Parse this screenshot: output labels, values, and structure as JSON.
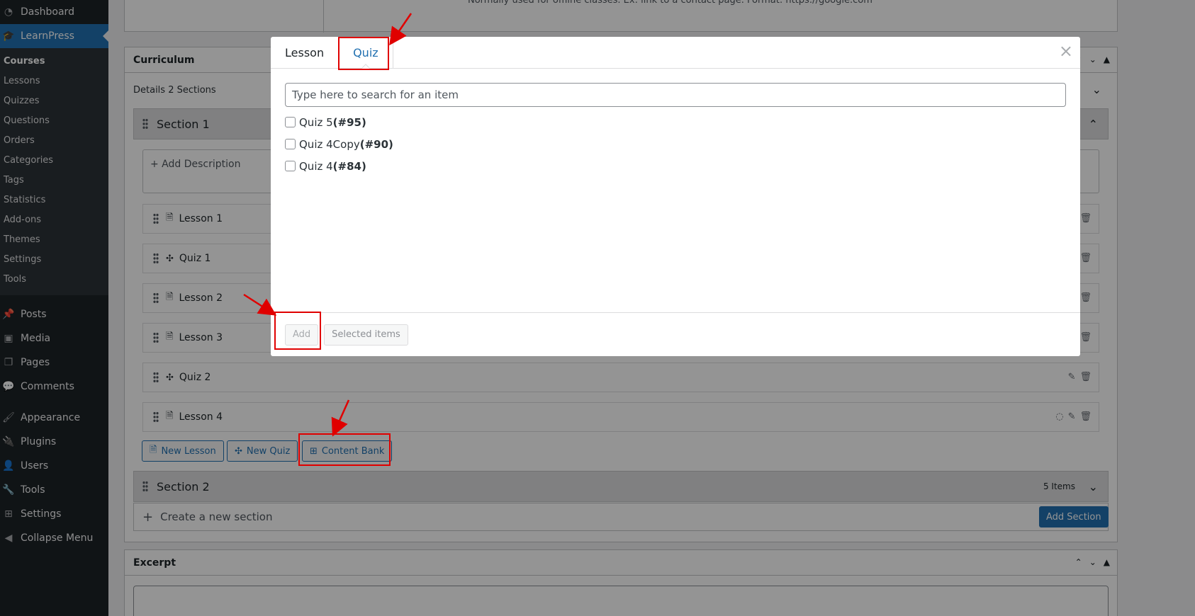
{
  "sidebar": {
    "dashboard": "Dashboard",
    "learnpress": "LearnPress",
    "learnpress_items": [
      "Courses",
      "Lessons",
      "Quizzes",
      "Questions",
      "Orders",
      "Categories",
      "Tags",
      "Statistics",
      "Add-ons",
      "Themes",
      "Settings",
      "Tools"
    ],
    "posts": "Posts",
    "media": "Media",
    "pages": "Pages",
    "comments": "Comments",
    "appearance": "Appearance",
    "plugins": "Plugins",
    "users": "Users",
    "tools": "Tools",
    "settings": "Settings",
    "collapse": "Collapse Menu"
  },
  "top_note": "Normally used for offline classes. Ex: link to a contact page. Format: https://google.com",
  "curriculum": {
    "title": "Curriculum",
    "details_label": "Details",
    "sections_count": "2 Sections",
    "section1": "Section 1",
    "add_description": "+ Add Description",
    "items": [
      "Lesson 1",
      "Quiz 1",
      "Lesson 2",
      "Lesson 3",
      "Quiz 2",
      "Lesson 4"
    ],
    "new_lesson": "New Lesson",
    "new_quiz": "New Quiz",
    "content_bank": "Content Bank",
    "section2": "Section 2",
    "section2_count": "5 Items",
    "create_section_placeholder": "Create a new section",
    "add_section": "Add Section"
  },
  "excerpt": {
    "title": "Excerpt"
  },
  "modal": {
    "tab_lesson": "Lesson",
    "tab_quiz": "Quiz",
    "close": "×",
    "search_placeholder": "Type here to search for an item",
    "options": [
      {
        "name": "Quiz 5",
        "id": "(#95)"
      },
      {
        "name": "Quiz 4Copy",
        "id": "(#90)"
      },
      {
        "name": "Quiz 4",
        "id": "(#84)"
      }
    ],
    "add_button": "Add",
    "selected_items": "Selected items"
  },
  "colors": {
    "accent": "#2271b1",
    "annotation": "#e00000",
    "sidebar": "#1d2327"
  }
}
